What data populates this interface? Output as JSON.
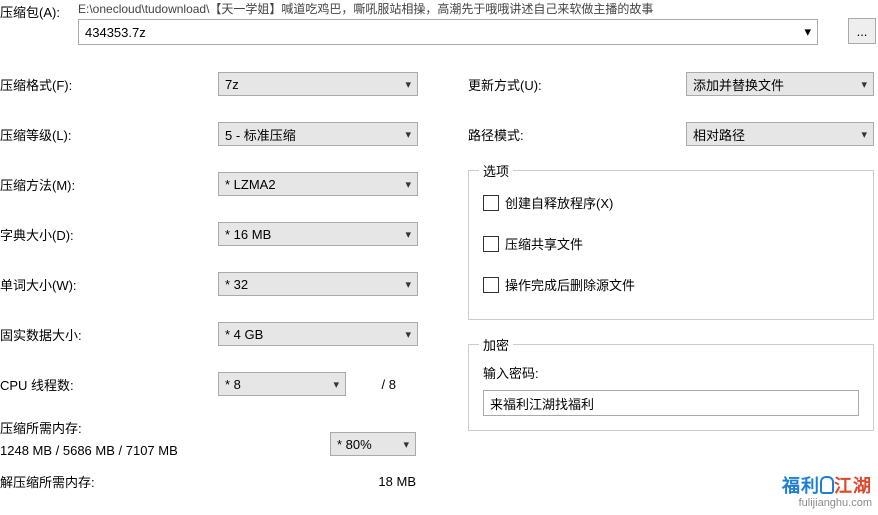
{
  "top": {
    "archive_label": "压缩包(A):",
    "path_truncated": "E:\\onecloud\\tudownload\\【天一学姐】喊道吃鸡巴，嘶吼服站相操，高潮先于哦哦讲述自己来软做主播的故事",
    "archive_name": "434353.7z",
    "browse": "..."
  },
  "left": {
    "format_label": "压缩格式(F):",
    "format_value": "7z",
    "level_label": "压缩等级(L):",
    "level_value": "5 - 标准压缩",
    "method_label": "压缩方法(M):",
    "method_value": "* LZMA2",
    "dict_label": "字典大小(D):",
    "dict_value": "* 16 MB",
    "word_label": "单词大小(W):",
    "word_value": "* 32",
    "solid_label": "固实数据大小:",
    "solid_value": "* 4 GB",
    "threads_label": "CPU 线程数:",
    "threads_value": "* 8",
    "threads_max": "/ 8",
    "mem_compress_label": "压缩所需内存:",
    "mem_compress_value": "1248 MB / 5686 MB / 7107 MB",
    "mem_percent": "* 80%",
    "mem_decompress_label": "解压缩所需内存:",
    "mem_decompress_value": "18 MB"
  },
  "right": {
    "update_label": "更新方式(U):",
    "update_value": "添加并替换文件",
    "pathmode_label": "路径模式:",
    "pathmode_value": "相对路径",
    "options_legend": "选项",
    "opt_sfx": "创建自释放程序(X)",
    "opt_shared": "压缩共享文件",
    "opt_delete": "操作完成后删除源文件",
    "encrypt_legend": "加密",
    "password_label": "输入密码:",
    "password_value": "来福利江湖找福利"
  },
  "watermark": {
    "brand": "福利江湖",
    "url": "fulijianghu.com"
  }
}
